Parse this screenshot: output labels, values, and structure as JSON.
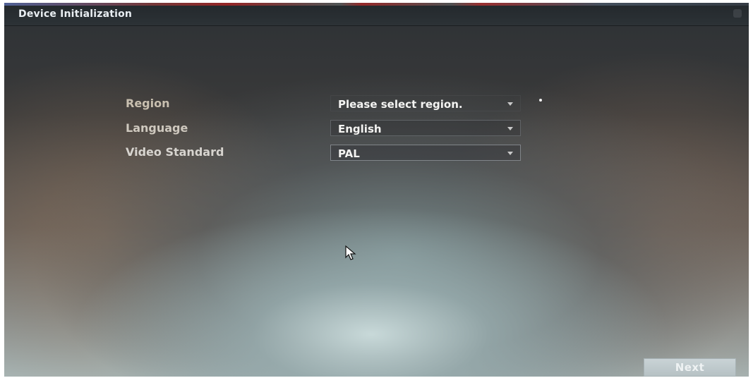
{
  "window": {
    "title": "Device Initialization"
  },
  "form": {
    "fields": [
      {
        "label": "Region",
        "value": "Please select region."
      },
      {
        "label": "Language",
        "value": "English"
      },
      {
        "label": "Video Standard",
        "value": "PAL"
      }
    ]
  },
  "footer": {
    "next_label": "Next"
  },
  "icons": {
    "dropdown": "chevron-down-icon",
    "pointer": "cursor-icon",
    "close": "close-icon"
  }
}
